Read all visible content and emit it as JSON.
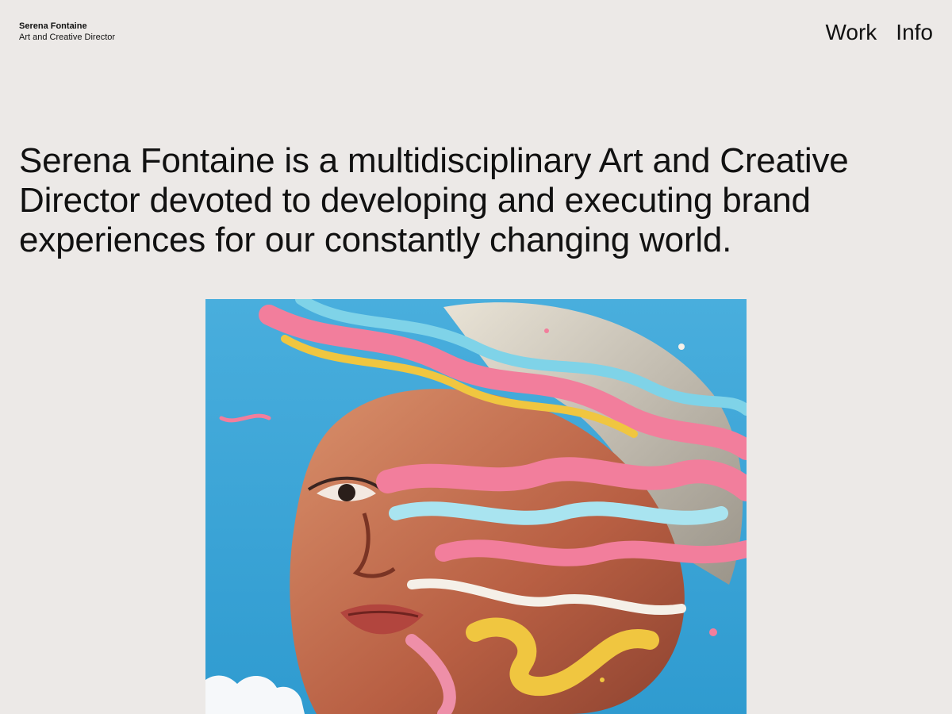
{
  "header": {
    "brand_name": "Serena Fontaine",
    "brand_role": "Art and Creative Director",
    "nav": [
      {
        "label": "Work"
      },
      {
        "label": "Info"
      }
    ]
  },
  "intro": {
    "text": "Serena Fontaine is a multidisciplinary Art and Creative Director devoted to developing and executing brand experiences for our constantly changing world."
  },
  "hero": {
    "image_icon": "portrait-artwork",
    "colors": {
      "sky": "#3AA6D8",
      "pink": "#F27E9C",
      "yellow": "#F0C640",
      "skin": "#C8714F"
    }
  },
  "theme": {
    "background": "#ECE9E7",
    "text": "#111111"
  }
}
